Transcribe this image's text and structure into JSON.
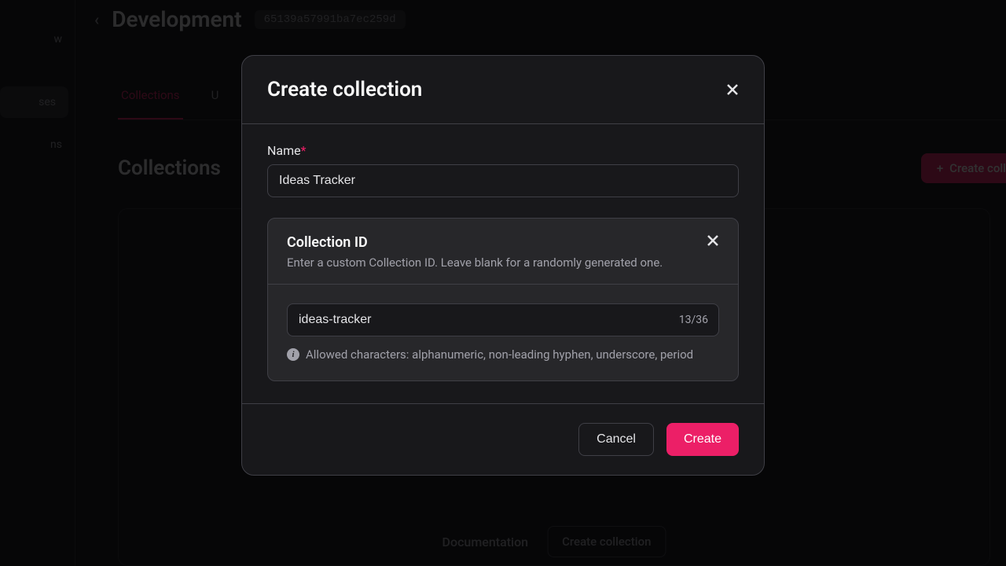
{
  "sidebar": {
    "items": [
      {
        "label": "w"
      },
      {
        "label": "ses"
      },
      {
        "label": "ns"
      }
    ]
  },
  "header": {
    "back_chevron": "‹",
    "title": "Development",
    "hash": "65139a57991ba7ec259d"
  },
  "tabs": [
    {
      "label": "Collections",
      "active": true
    },
    {
      "label": "U"
    }
  ],
  "section": {
    "title": "Collections",
    "create_button": "Create coll"
  },
  "empty_state": {
    "doc_link": "Documentation",
    "action_button": "Create collection"
  },
  "modal": {
    "title": "Create collection",
    "name_label": "Name",
    "name_value": "Ideas Tracker",
    "id_section": {
      "title": "Collection ID",
      "description": "Enter a custom Collection ID. Leave blank for a randomly generated one.",
      "value": "ideas-tracker",
      "char_count": "13/36",
      "hint": "Allowed characters: alphanumeric, non-leading hyphen, underscore, period"
    },
    "cancel_label": "Cancel",
    "create_label": "Create"
  }
}
